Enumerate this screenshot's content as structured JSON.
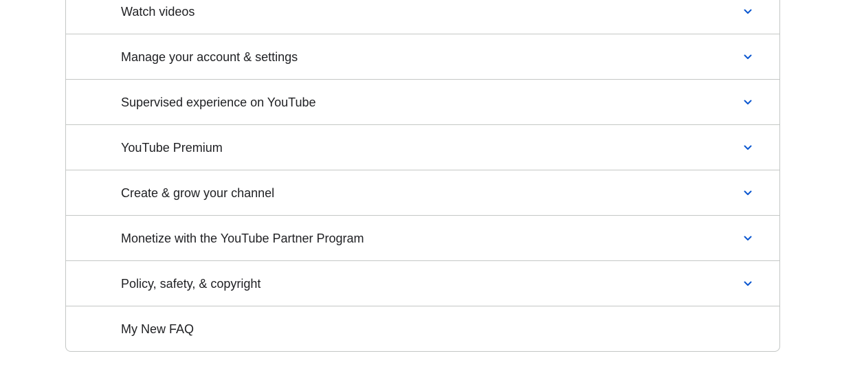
{
  "accent_color": "#0b57d0",
  "faq_sections": [
    {
      "label": "Watch videos",
      "expandable": true,
      "icon": "chevron-down-icon"
    },
    {
      "label": "Manage your account & settings",
      "expandable": true,
      "icon": "chevron-down-icon"
    },
    {
      "label": "Supervised experience on YouTube",
      "expandable": true,
      "icon": "chevron-down-icon"
    },
    {
      "label": "YouTube Premium",
      "expandable": true,
      "icon": "chevron-down-icon"
    },
    {
      "label": "Create & grow your channel",
      "expandable": true,
      "icon": "chevron-down-icon"
    },
    {
      "label": "Monetize with the YouTube Partner Program",
      "expandable": true,
      "icon": "chevron-down-icon"
    },
    {
      "label": "Policy, safety, & copyright",
      "expandable": true,
      "icon": "chevron-down-icon"
    },
    {
      "label": "My New FAQ",
      "expandable": false
    }
  ]
}
